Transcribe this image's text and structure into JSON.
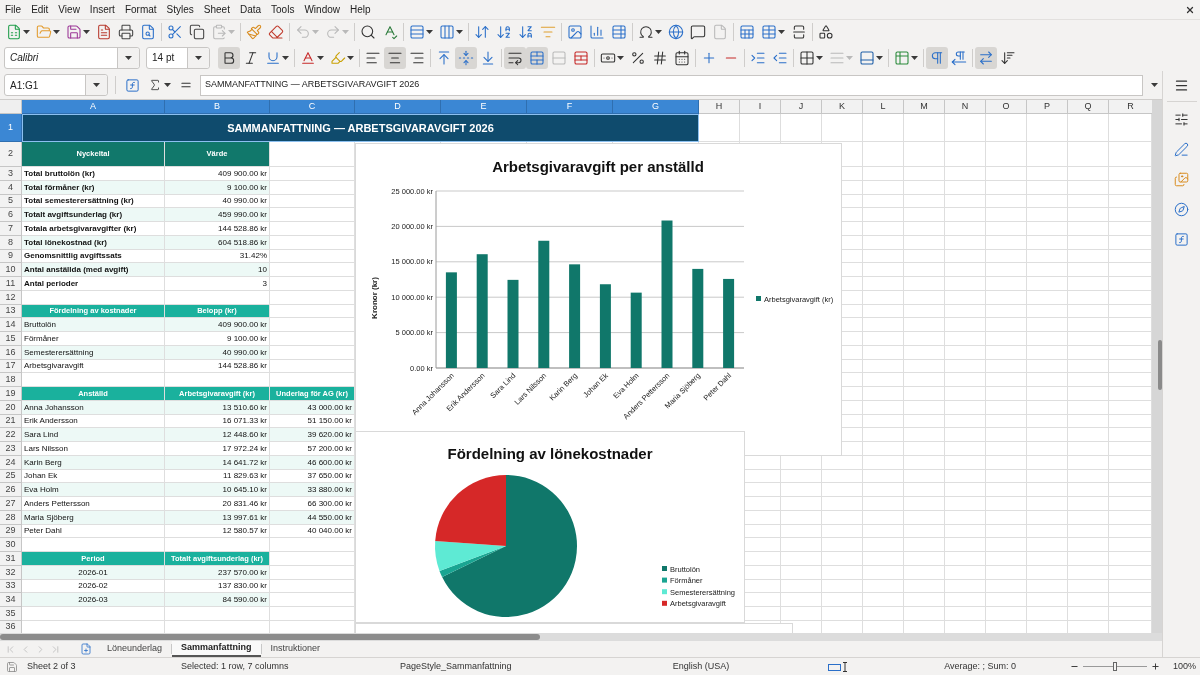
{
  "menu": [
    "File",
    "Edit",
    "View",
    "Insert",
    "Format",
    "Styles",
    "Sheet",
    "Data",
    "Tools",
    "Window",
    "Help"
  ],
  "toolbars": [
    {
      "groups": [
        {
          "items": [
            {
              "disabled": false,
              "dropdown": true
            },
            {
              "disabled": false,
              "dropdown": true
            },
            {
              "disabled": false,
              "dropdown": true
            },
            {
              "disabled": false,
              "dropdown": false
            },
            {
              "disabled": false,
              "dropdown": false
            },
            {
              "disabled": false,
              "dropdown": false
            }
          ]
        },
        {
          "items": [
            {
              "disabled": false,
              "dropdown": false
            },
            {
              "disabled": false,
              "dropdown": false
            },
            {
              "disabled": true,
              "dropdown": true
            }
          ]
        },
        {
          "items": [
            {
              "disabled": false,
              "dropdown": false
            },
            {
              "disabled": false,
              "dropdown": false
            }
          ]
        },
        {
          "items": [
            {
              "disabled": true,
              "dropdown": true
            },
            {
              "disabled": true,
              "dropdown": true
            }
          ]
        },
        {
          "items": [
            {
              "disabled": false,
              "dropdown": false
            },
            {
              "disabled": false,
              "dropdown": false
            }
          ]
        },
        {
          "items": [
            {
              "disabled": false,
              "dropdown": true
            },
            {
              "disabled": false,
              "dropdown": true
            }
          ]
        },
        {
          "items": [
            {
              "disabled": false,
              "dropdown": false
            },
            {
              "disabled": false,
              "dropdown": false
            },
            {
              "disabled": false,
              "dropdown": false
            },
            {
              "disabled": false,
              "dropdown": false
            }
          ]
        },
        {
          "items": [
            {
              "disabled": false,
              "dropdown": false
            },
            {
              "disabled": false,
              "dropdown": false
            },
            {
              "disabled": false,
              "dropdown": false
            }
          ]
        },
        {
          "items": [
            {
              "disabled": false,
              "dropdown": true
            },
            {
              "disabled": false,
              "dropdown": false
            },
            {
              "disabled": false,
              "dropdown": false
            },
            {
              "disabled": true,
              "dropdown": false
            }
          ]
        },
        {
          "items": [
            {
              "disabled": false,
              "dropdown": false
            },
            {
              "disabled": false,
              "dropdown": true
            },
            {
              "disabled": false,
              "dropdown": false
            }
          ]
        },
        {
          "items": [
            {
              "disabled": false,
              "dropdown": false
            }
          ]
        }
      ]
    },
    {
      "font_name": "Calibri",
      "font_size": "14 pt",
      "groups": [
        {
          "items": [
            {
              "pressed": true,
              "disabled": false,
              "dropdown": false
            },
            {
              "pressed": false,
              "disabled": false,
              "dropdown": false
            },
            {
              "pressed": false,
              "disabled": false,
              "dropdown": true
            }
          ]
        },
        {
          "items": [
            {
              "pressed": false,
              "disabled": false,
              "dropdown": true
            },
            {
              "pressed": false,
              "disabled": false,
              "dropdown": true
            }
          ]
        },
        {
          "items": [
            {
              "pressed": false,
              "disabled": false,
              "dropdown": false
            },
            {
              "pressed": true,
              "disabled": false,
              "dropdown": false
            },
            {
              "pressed": false,
              "disabled": false,
              "dropdown": false
            }
          ]
        },
        {
          "items": [
            {
              "pressed": false,
              "disabled": false,
              "dropdown": false
            },
            {
              "pressed": true,
              "disabled": false,
              "dropdown": false
            },
            {
              "pressed": false,
              "disabled": false,
              "dropdown": false
            }
          ]
        },
        {
          "items": [
            {
              "pressed": true,
              "disabled": false,
              "dropdown": false
            },
            {
              "pressed": true,
              "disabled": false,
              "dropdown": false
            },
            {
              "pressed": false,
              "disabled": true,
              "dropdown": false
            },
            {
              "pressed": false,
              "disabled": false,
              "dropdown": false
            }
          ]
        },
        {
          "items": [
            {
              "pressed": false,
              "disabled": false,
              "dropdown": true
            },
            {
              "pressed": false,
              "disabled": false,
              "dropdown": false
            },
            {
              "pressed": false,
              "disabled": false,
              "dropdown": false
            },
            {
              "pressed": false,
              "disabled": false,
              "dropdown": false
            }
          ]
        },
        {
          "items": [
            {
              "pressed": false,
              "disabled": false,
              "dropdown": false
            },
            {
              "pressed": false,
              "disabled": false,
              "dropdown": false
            }
          ]
        },
        {
          "items": [
            {
              "pressed": false,
              "disabled": false,
              "dropdown": false
            },
            {
              "pressed": false,
              "disabled": false,
              "dropdown": false
            }
          ]
        },
        {
          "items": [
            {
              "pressed": false,
              "disabled": false,
              "dropdown": true
            },
            {
              "pressed": false,
              "disabled": true,
              "dropdown": true
            },
            {
              "pressed": false,
              "disabled": false,
              "dropdown": true
            }
          ]
        },
        {
          "items": [
            {
              "pressed": false,
              "disabled": false,
              "dropdown": true
            }
          ]
        },
        {
          "items": [
            {
              "pressed": true,
              "disabled": false,
              "dropdown": false
            },
            {
              "pressed": false,
              "disabled": false,
              "dropdown": false
            }
          ]
        },
        {
          "items": [
            {
              "pressed": true,
              "disabled": false,
              "dropdown": false
            },
            {
              "pressed": false,
              "disabled": false,
              "dropdown": false
            }
          ]
        }
      ]
    }
  ],
  "formula_bar": {
    "cell_ref": "A1:G1",
    "content": "SAMMANFATTNING — ARBETSGIVARAVGIFT 2026"
  },
  "sheet": {
    "columns": [
      {
        "label": "A",
        "selected": true
      },
      {
        "label": "B",
        "selected": true
      },
      {
        "label": "C",
        "selected": true
      },
      {
        "label": "D",
        "selected": true
      },
      {
        "label": "E",
        "selected": true
      },
      {
        "label": "F",
        "selected": true
      },
      {
        "label": "G",
        "selected": true
      },
      {
        "label": "H",
        "selected": false
      },
      {
        "label": "I",
        "selected": false
      },
      {
        "label": "J",
        "selected": false
      },
      {
        "label": "K",
        "selected": false
      },
      {
        "label": "L",
        "selected": false
      },
      {
        "label": "M",
        "selected": false
      },
      {
        "label": "N",
        "selected": false
      },
      {
        "label": "O",
        "selected": false
      },
      {
        "label": "P",
        "selected": false
      },
      {
        "label": "Q",
        "selected": false
      },
      {
        "label": "R",
        "selected": false
      }
    ],
    "rows": [
      {
        "label": "1",
        "selected": true
      },
      {
        "label": "2",
        "selected": false
      },
      {
        "label": "3",
        "selected": false
      },
      {
        "label": "4",
        "selected": false
      },
      {
        "label": "5",
        "selected": false
      },
      {
        "label": "6",
        "selected": false
      },
      {
        "label": "7",
        "selected": false
      },
      {
        "label": "8",
        "selected": false
      },
      {
        "label": "9",
        "selected": false
      },
      {
        "label": "10",
        "selected": false
      },
      {
        "label": "11",
        "selected": false
      },
      {
        "label": "12",
        "selected": false
      },
      {
        "label": "13",
        "selected": false
      },
      {
        "label": "14",
        "selected": false
      },
      {
        "label": "15",
        "selected": false
      },
      {
        "label": "16",
        "selected": false
      },
      {
        "label": "17",
        "selected": false
      },
      {
        "label": "18",
        "selected": false
      },
      {
        "label": "19",
        "selected": false
      },
      {
        "label": "20",
        "selected": false
      },
      {
        "label": "21",
        "selected": false
      },
      {
        "label": "22",
        "selected": false
      },
      {
        "label": "23",
        "selected": false
      },
      {
        "label": "24",
        "selected": false
      },
      {
        "label": "25",
        "selected": false
      },
      {
        "label": "26",
        "selected": false
      },
      {
        "label": "27",
        "selected": false
      },
      {
        "label": "28",
        "selected": false
      },
      {
        "label": "29",
        "selected": false
      },
      {
        "label": "30",
        "selected": false
      },
      {
        "label": "31",
        "selected": false
      },
      {
        "label": "32",
        "selected": false
      },
      {
        "label": "33",
        "selected": false
      },
      {
        "label": "34",
        "selected": false
      },
      {
        "label": "35",
        "selected": false
      },
      {
        "label": "36",
        "selected": false
      }
    ],
    "title": {
      "text": "SAMMANFATTNING — ARBETSGIVARAVGIFT 2026",
      "selected": true
    },
    "tables": [
      {
        "kind": "summary",
        "header": [
          "Nyckeltal",
          "Värde"
        ],
        "rows": [
          [
            "Total bruttolön (kr)",
            "409 900.00 kr"
          ],
          [
            "Total förmåner (kr)",
            "9 100.00 kr"
          ],
          [
            "Total semesterersättning (kr)",
            "40 990.00 kr"
          ],
          [
            "Totalt avgiftsunderlag (kr)",
            "459 990.00 kr"
          ],
          [
            "Totala arbetsgivaravgifter (kr)",
            "144 528.86 kr"
          ],
          [
            "Total lönekostnad (kr)",
            "604 518.86 kr"
          ],
          [
            "Genomsnittlig avgiftssats",
            "31.42%"
          ],
          [
            "Antal anställda (med avgift)",
            "10"
          ],
          [
            "Antal perioder",
            "3"
          ]
        ]
      },
      {
        "kind": "list",
        "header": [
          "Fördelning av kostnader",
          "Belopp (kr)"
        ],
        "rows": [
          [
            "Bruttolön",
            "409 900.00 kr"
          ],
          [
            "Förmåner",
            "9 100.00 kr"
          ],
          [
            "Semesterersättning",
            "40 990.00 kr"
          ],
          [
            "Arbetsgivaravgift",
            "144 528.86 kr"
          ]
        ]
      },
      {
        "kind": "list",
        "header": [
          "Anställd",
          "Arbetsgivaravgift (kr)",
          "Underlag för AG (kr)"
        ],
        "rows": [
          [
            "Anna Johansson",
            "13 510.60 kr",
            "43 000.00 kr"
          ],
          [
            "Erik Andersson",
            "16 071.33 kr",
            "51 150.00 kr"
          ],
          [
            "Sara Lind",
            "12 448.60 kr",
            "39 620.00 kr"
          ],
          [
            "Lars Nilsson",
            "17 972.24 kr",
            "57 200.00 kr"
          ],
          [
            "Karin Berg",
            "14 641.72 kr",
            "46 600.00 kr"
          ],
          [
            "Johan Ek",
            "11 829.63 kr",
            "37 650.00 kr"
          ],
          [
            "Eva Holm",
            "10 645.10 kr",
            "33 880.00 kr"
          ],
          [
            "Anders Pettersson",
            "20 831.46 kr",
            "66 300.00 kr"
          ],
          [
            "Maria Sjöberg",
            "13 997.61 kr",
            "44 550.00 kr"
          ],
          [
            "Peter Dahl",
            "12 580.57 kr",
            "40 040.00 kr"
          ]
        ]
      },
      {
        "kind": "period",
        "header": [
          "Period",
          "Totalt avgiftsunderlag (kr)"
        ],
        "rows": [
          [
            "2026-01",
            "237 570.00 kr"
          ],
          [
            "2026-02",
            "137 830.00 kr"
          ],
          [
            "2026-03",
            "84 590.00 kr"
          ]
        ]
      }
    ],
    "charts": [
      {
        "chart_data": {
          "type": "bar",
          "title": "Arbetsgivaravgift per anställd",
          "ylabel": "Kronor (kr)",
          "categories": [
            "Anna Johansson",
            "Erik Andersson",
            "Sara Lind",
            "Lars Nilsson",
            "Karin Berg",
            "Johan Ek",
            "Eva Holm",
            "Anders Pettersson",
            "Maria Sjöberg",
            "Peter Dahl"
          ],
          "series": [
            {
              "name": "Arbetsgivaravgift (kr)",
              "color": "#10776a",
              "values": [
                13510.6,
                16071.33,
                12448.6,
                17972.24,
                14641.72,
                11829.63,
                10645.1,
                20831.46,
                13997.61,
                12580.57
              ]
            }
          ],
          "ylim": [
            0,
            25000
          ],
          "yticks": [
            {
              "value": 0,
              "label": "0.00 kr"
            },
            {
              "value": 5000,
              "label": "5 000.00 kr"
            },
            {
              "value": 10000,
              "label": "10 000.00 kr"
            },
            {
              "value": 15000,
              "label": "15 000.00 kr"
            },
            {
              "value": 20000,
              "label": "20 000.00 kr"
            },
            {
              "value": 25000,
              "label": "25 000.00 kr"
            }
          ],
          "grid": true,
          "legend": "right"
        }
      },
      {
        "chart_data": {
          "type": "pie",
          "title": "Fördelning av lönekostnader",
          "categories": [
            "Bruttolön",
            "Förmåner",
            "Semesterersättning",
            "Arbetsgivaravgift"
          ],
          "values": [
            67.8,
            1.5,
            6.8,
            23.9
          ],
          "colors": [
            "#10776a",
            "#1aa592",
            "#5eead4",
            "#d62828"
          ],
          "legend": "right"
        }
      }
    ]
  },
  "sheet_tabs": [
    {
      "label": "Löneunderlag",
      "selected": false
    },
    {
      "label": "Sammanfattning",
      "selected": true
    },
    {
      "label": "Instruktioner",
      "selected": false
    }
  ],
  "status_bar": {
    "sheet_info": "Sheet 2 of 3",
    "selection": "Selected: 1 row, 7 columns",
    "page_style": "PageStyle_Sammanfattning",
    "language": "English (USA)",
    "summary": "Average: ; Sum: 0",
    "zoom": {
      "level": 0.5,
      "reading": "100%"
    }
  }
}
